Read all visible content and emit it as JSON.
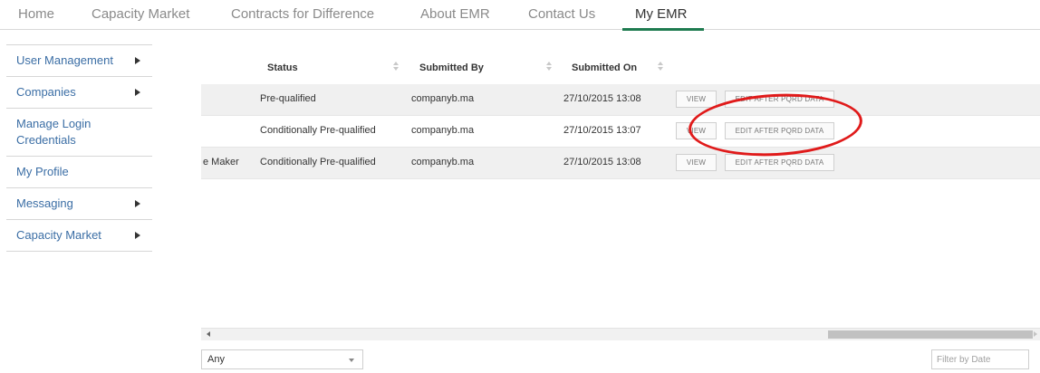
{
  "nav": {
    "items": [
      {
        "label": "Home"
      },
      {
        "label": "Capacity Market"
      },
      {
        "label": "Contracts for Difference"
      },
      {
        "label": "About EMR"
      },
      {
        "label": "Contact Us"
      },
      {
        "label": "My EMR",
        "active": true
      }
    ],
    "accent_color": "#1e7b50"
  },
  "sidebar": {
    "items": [
      {
        "label": "User Management",
        "has_submenu": true
      },
      {
        "label": "Companies",
        "has_submenu": true
      },
      {
        "label": "Manage Login Credentials",
        "has_submenu": false
      },
      {
        "label": "My Profile",
        "has_submenu": false
      },
      {
        "label": "Messaging",
        "has_submenu": true
      },
      {
        "label": "Capacity Market",
        "has_submenu": true
      }
    ]
  },
  "table": {
    "columns": [
      "Status",
      "Submitted By",
      "Submitted On"
    ],
    "rows": [
      {
        "truncated_left": "",
        "status": "Pre-qualified",
        "submitted_by": "companyb.ma",
        "submitted_on": "27/10/2015 13:08",
        "view_label": "VIEW",
        "edit_label": "EDIT AFTER PQRD DATA"
      },
      {
        "truncated_left": "",
        "status": "Conditionally Pre-qualified",
        "submitted_by": "companyb.ma",
        "submitted_on": "27/10/2015 13:07",
        "view_label": "VIEW",
        "edit_label": "EDIT AFTER PQRD DATA"
      },
      {
        "truncated_left": "e Maker",
        "status": "Conditionally Pre-qualified",
        "submitted_by": "companyb.ma",
        "submitted_on": "27/10/2015 13:08",
        "view_label": "VIEW",
        "edit_label": "EDIT AFTER PQRD DATA"
      }
    ]
  },
  "filters": {
    "status_select_value": "Any",
    "date_placeholder": "Filter by Date"
  },
  "annotation_color": "#e01a1a"
}
